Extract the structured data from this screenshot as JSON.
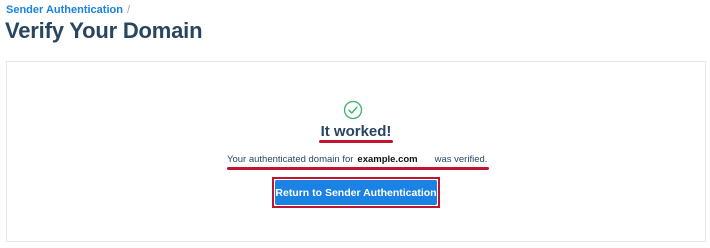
{
  "breadcrumb": {
    "parent_label": "Sender Authentication",
    "separator": "/"
  },
  "page": {
    "title": "Verify Your Domain"
  },
  "result": {
    "icon": "check-circle-icon",
    "headline": "It worked!",
    "prefix_text": "Your authenticated domain for",
    "domain": "example.com",
    "suffix_text": "was verified.",
    "button_label": "Return to Sender Authentication"
  },
  "colors": {
    "brand_blue": "#1a82e2",
    "title_text": "#294661",
    "success_green": "#3bb26b",
    "annotation_red": "#c0142f"
  }
}
